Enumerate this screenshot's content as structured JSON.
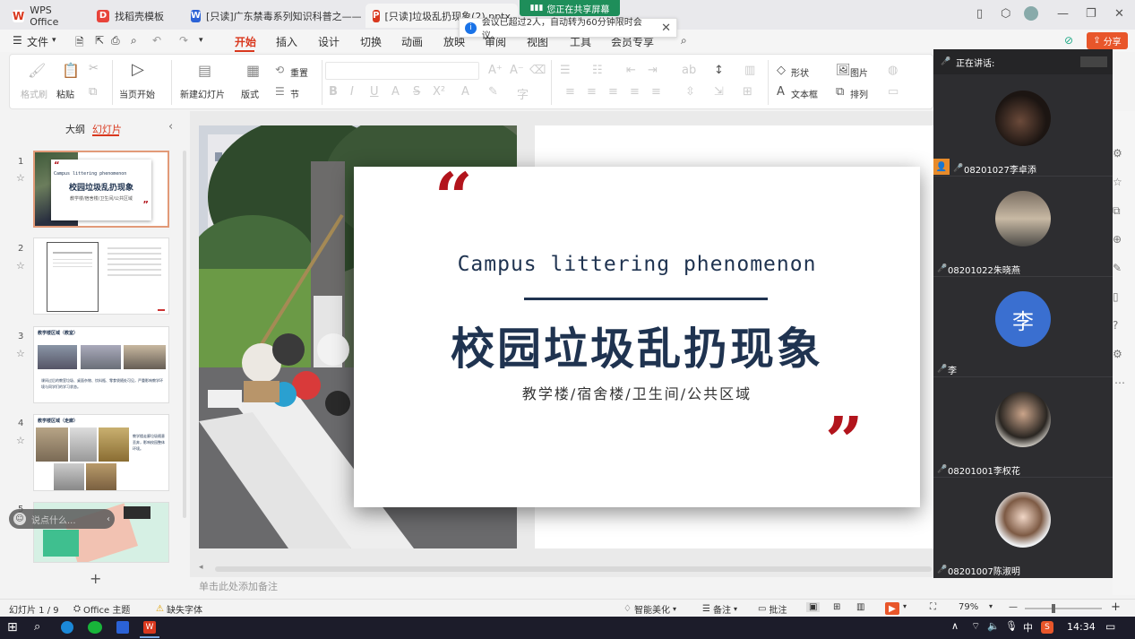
{
  "tabs": [
    {
      "label": "WPS Office",
      "icon": "wps-logo-icon"
    },
    {
      "label": "找稻壳模板",
      "icon": "docer-icon"
    },
    {
      "label": "[只读]广东禁毒系列知识科普之——校",
      "icon": "word-doc-icon"
    },
    {
      "label": "[只读]垃圾乱扔现象(2).pptx",
      "icon": "ppt-doc-icon"
    }
  ],
  "screen_share": {
    "label": "您正在共享屏幕"
  },
  "meeting_notice": {
    "text": "会议已超过2人，自动转为60分钟限时会议。"
  },
  "menu": {
    "file": "文件",
    "items": [
      "开始",
      "插入",
      "设计",
      "切换",
      "动画",
      "放映",
      "审阅",
      "视图",
      "工具",
      "会员专享"
    ],
    "active": "开始",
    "share": "分享"
  },
  "ribbon": {
    "format_painter": "格式刷",
    "paste": "粘贴",
    "from_current": "当页开始",
    "new_slide": "新建幻灯片",
    "layout": "版式",
    "reset": "重置",
    "section": "节",
    "shapes": "形状",
    "picture": "图片",
    "textbox": "文本框",
    "arrange": "排列"
  },
  "panel": {
    "outline": "大纲",
    "slides": "幻灯片",
    "active": "幻灯片"
  },
  "thumbnails": [
    {
      "num": "1",
      "title_en": "Campus littering phenomenon",
      "title_cn": "校园垃圾乱扔现象",
      "sub": "教学楼/宿舍楼/卫生间/公共区域"
    },
    {
      "num": "2"
    },
    {
      "num": "3",
      "heading": "教学楼区域（教室）",
      "caption": "课间过后的教室垃圾、桌面杂物、饮料瓶、零食袋随处可见，严重影响教学环境与同学们的学习状态。"
    },
    {
      "num": "4",
      "heading": "教学楼区域（走廊）",
      "caption": "教学楼走廊垃圾随意丢弃，影响校园整体环境。"
    },
    {
      "num": "5"
    }
  ],
  "slide": {
    "title_en": "Campus littering phenomenon",
    "title_cn": "校园垃圾乱扔现象",
    "subtitle": "教学楼/宿舍楼/卫生间/公共区域",
    "quote_open": "“",
    "quote_close": "”"
  },
  "notes_placeholder": "单击此处添加备注",
  "chat_placeholder": "说点什么...",
  "meeting": {
    "speaking_label": "正在讲话:",
    "participants": [
      {
        "name": "08201027李卓添",
        "avatar": "photo"
      },
      {
        "name": "08201022朱晓燕",
        "avatar": "photo"
      },
      {
        "name": "李",
        "avatar": "letter",
        "letter": "李"
      },
      {
        "name": "08201001李权花",
        "avatar": "photo"
      },
      {
        "name": "08201007陈淑明",
        "avatar": "photo"
      }
    ]
  },
  "status": {
    "slide_counter": "幻灯片 1 / 9",
    "theme": "Office 主题",
    "missing_font": "缺失字体",
    "smart_beautify": "智能美化",
    "notes": "备注",
    "comments": "批注",
    "zoom": "79%"
  },
  "taskbar": {
    "time": "14:34",
    "ime": "中"
  },
  "colors": {
    "accent": "#d9381e",
    "quote_red": "#b2141c",
    "title_navy": "#1f3350",
    "meeting_bg": "#2d2d30",
    "avatar_blue": "#3a6fd0"
  }
}
